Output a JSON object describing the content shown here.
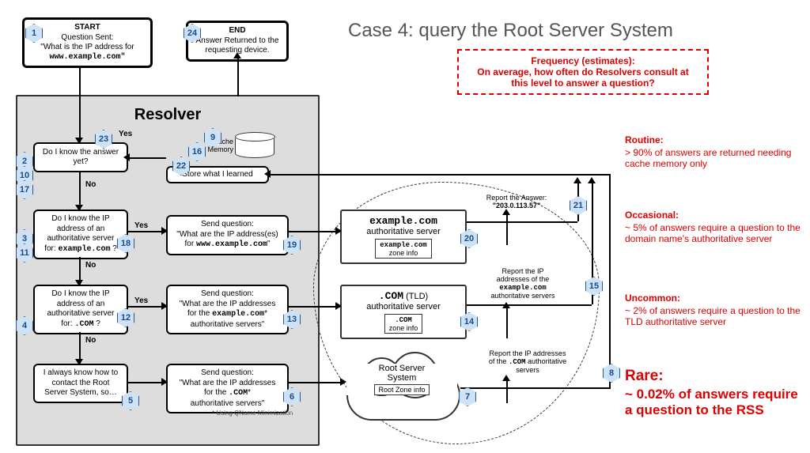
{
  "title": "Case 4: query the Root Server System",
  "start": {
    "heading": "START",
    "line1": "Question Sent:",
    "line2": "\"What is the IP address for",
    "line3": "www.example.com\""
  },
  "end": {
    "heading": "END",
    "line1": "Answer Returned to the",
    "line2": "requesting device."
  },
  "resolver": {
    "title": "Resolver",
    "q_answer": "Do I know the answer yet?",
    "q_auth_domain_l1": "Do I know the IP",
    "q_auth_domain_l2": "address of an",
    "q_auth_domain_l3": "authoritative server",
    "q_auth_domain_l4": "for: example.com ?",
    "q_auth_tld_l1": "Do I know the IP",
    "q_auth_tld_l2": "address of an",
    "q_auth_tld_l3": "authoritative server",
    "q_auth_tld_l4": "for: .COM ?",
    "q_root_l1": "I always know how to",
    "q_root_l2": "contact the Root",
    "q_root_l3": "Server System, so…",
    "send_domain_l1": "Send question:",
    "send_domain_l2": "\"What are the IP address(es)",
    "send_domain_l3": "for www.example.com\"",
    "send_tld_l1": "Send question:",
    "send_tld_l2": "\"What are the IP addresses",
    "send_tld_l3": "for the example.com*",
    "send_tld_l4": "authoritative servers\"",
    "send_root_l1": "Send question:",
    "send_root_l2": "\"What are the IP addresses",
    "send_root_l3": "for the .COM*",
    "send_root_l4": "authoritative servers\"",
    "cache_label": "Cache Memory",
    "store": "Store what I learned",
    "footnote": "* Using QName Minimization",
    "yes": "Yes",
    "no": "No"
  },
  "servers": {
    "domain_name": "example.com",
    "domain_sub": "authoritative server",
    "domain_zone": "example.com zone info",
    "tld_name": ".COM (TLD)",
    "tld_sub": "authoritative server",
    "tld_zone": ".COM zone info",
    "root_name": "Root Server System",
    "root_zone": "Root Zone info"
  },
  "reports": {
    "answer_l1": "Report the Answer:",
    "answer_l2": "\"203.0.113.57\"",
    "domain_l1": "Report the IP",
    "domain_l2": "addresses of the",
    "domain_l3": "example.com",
    "domain_l4": "authoritative servers",
    "tld_l1": "Report the IP addresses",
    "tld_l2": "of the .COM authoritative",
    "tld_l3": "servers"
  },
  "freq": {
    "heading": "Frequency (estimates):",
    "sub": "On average, how often do Resolvers consult at this level to answer a question?",
    "routine_h": "Routine:",
    "routine_t": "> 90% of answers are returned needing cache memory only",
    "occasional_h": "Occasional:",
    "occasional_t": "~ 5% of answers require a question to the domain name's authoritative server",
    "uncommon_h": "Uncommon:",
    "uncommon_t": "~ 2% of answers require a question to the TLD authoritative server",
    "rare_h": "Rare:",
    "rare_t": "~ 0.02% of answers require a question to the RSS"
  },
  "steps": {
    "s1": "1",
    "s2": "2",
    "s3": "3",
    "s4": "4",
    "s5": "5",
    "s6": "6",
    "s7": "7",
    "s8": "8",
    "s9": "9",
    "s10": "10",
    "s11": "11",
    "s12": "12",
    "s13": "13",
    "s14": "14",
    "s15": "15",
    "s16": "16",
    "s17": "17",
    "s18": "18",
    "s19": "19",
    "s20": "20",
    "s21": "21",
    "s22": "22",
    "s23": "23",
    "s24": "24"
  }
}
